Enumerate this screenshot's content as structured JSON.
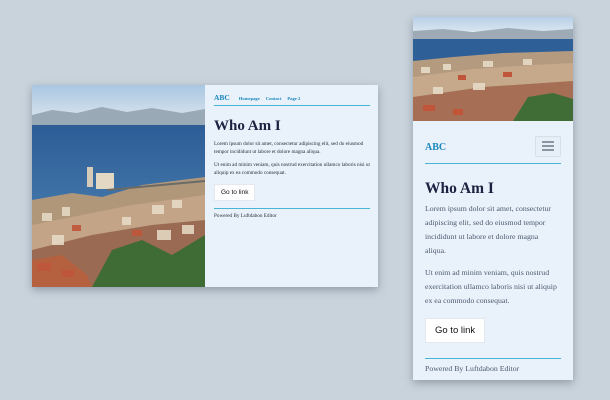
{
  "brand": "ABC",
  "nav": [
    "Homepage",
    "Contact",
    "Page 2"
  ],
  "title": "Who Am I",
  "para1": "Lorem ipsum dolor sit amet, consectetur adipiscing elit, sed do eiusmod tempor incididunt ut labore et dolore magna aliqua.",
  "para2": "Ut enim ad minim veniam, quis nostrud exercitation ullamco laboris nisi ut aliquip ex ea commodo consequat.",
  "button": "Go to link",
  "footer": "Powered By Luftdabon Editor",
  "icons": {
    "menu": "hamburger-menu-icon",
    "photo": "harbor-city-photo"
  },
  "colors": {
    "accent": "#1a88be",
    "rule": "#49b4d4",
    "background": "#c9d3dc",
    "card": "#e9f1fb",
    "heading": "#1d2240"
  }
}
